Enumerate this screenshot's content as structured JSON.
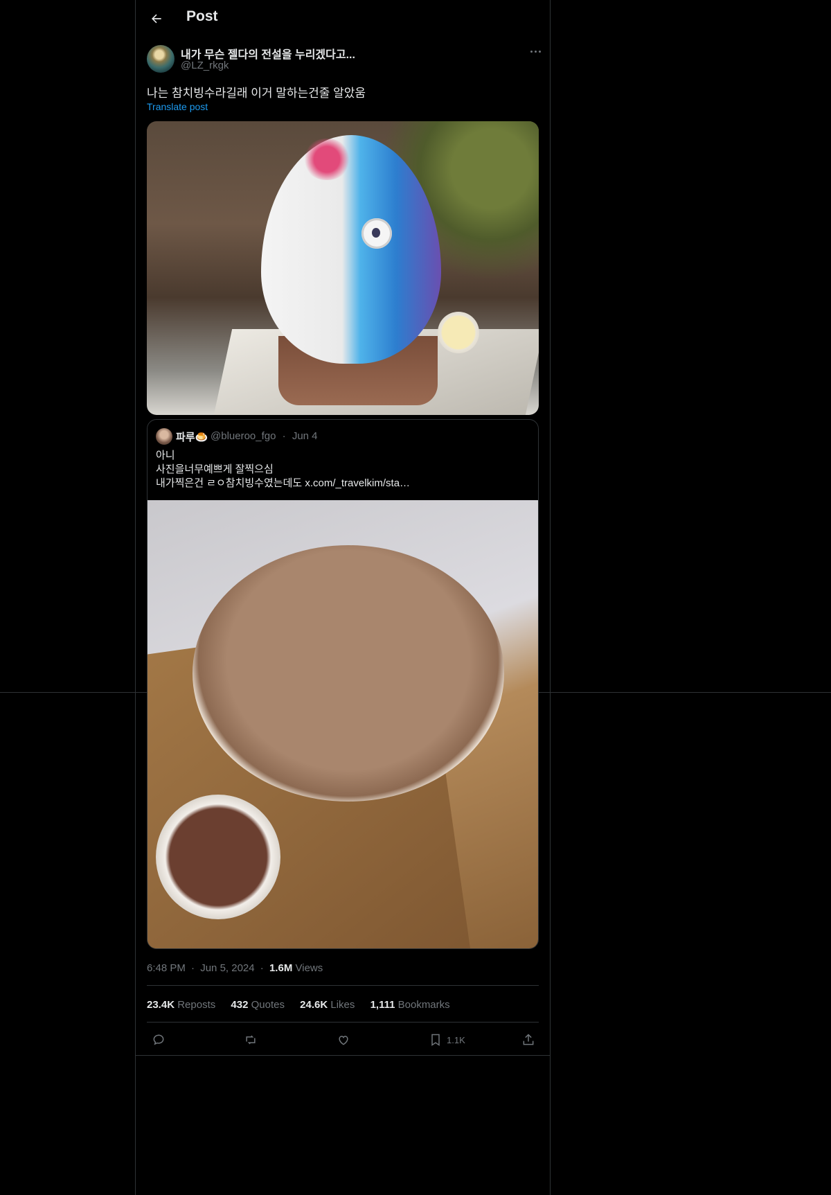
{
  "header": {
    "title": "Post"
  },
  "post": {
    "author": {
      "display_name": "내가 무슨 젤다의 전설을 누리겠다고...",
      "handle": "@LZ_rkgk"
    },
    "text": "나는 참치빙수라길래 이거 말하는건줄 알았움",
    "translate_label": "Translate post",
    "time": "6:48 PM",
    "date": "Jun 5, 2024",
    "views_count": "1.6M",
    "views_label": "Views",
    "separator": "·"
  },
  "quote": {
    "display_name": "파루🍮",
    "handle": "@blueroo_fgo",
    "date": "Jun 4",
    "lines": [
      "아니",
      "사진을너무예쁘게 잘찍으심",
      "내가찍은건 ㄹㅇ참치빙수였는데도  x.com/_travelkim/sta…"
    ]
  },
  "stats": {
    "reposts": {
      "count": "23.4K",
      "label": "Reposts"
    },
    "quotes": {
      "count": "432",
      "label": "Quotes"
    },
    "likes": {
      "count": "24.6K",
      "label": "Likes"
    },
    "bookmarks": {
      "count": "1,111",
      "label": "Bookmarks"
    }
  },
  "actions": {
    "bookmark_count": "1.1K"
  },
  "icons": [
    "back-arrow-icon",
    "more-icon",
    "reply-icon",
    "repost-icon",
    "like-icon",
    "bookmark-icon",
    "share-icon"
  ],
  "colors": {
    "background": "#000000",
    "text": "#e7e9ea",
    "muted": "#71767b",
    "link": "#1d9bf0",
    "border": "#2f3336"
  }
}
